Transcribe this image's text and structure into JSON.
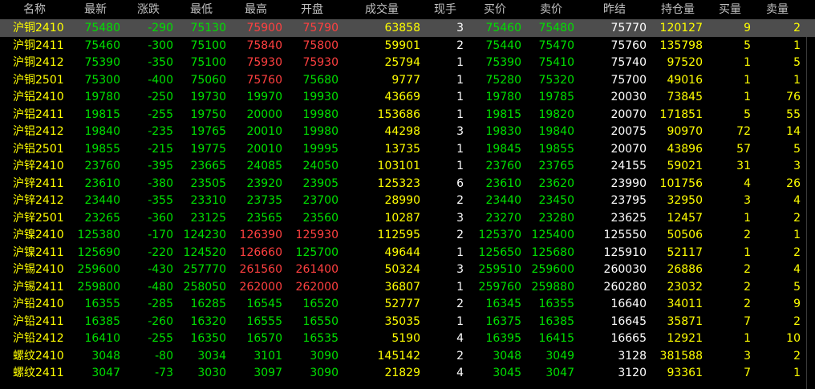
{
  "colors": {
    "background": "#000000",
    "header_text": "#c0c0c0",
    "selected_row_bg": "#4d4d4d",
    "name": "#ffff00",
    "green": "#00e000",
    "red": "#ff4040",
    "white": "#ffffff",
    "yellow": "#ffff00"
  },
  "columns": [
    "名称",
    "最新",
    "涨跌",
    "最低",
    "最高",
    "开盘",
    "成交量",
    "现手",
    "买价",
    "卖价",
    "昨结",
    "持仓量",
    "买量",
    "卖量"
  ],
  "selected_row": 0,
  "rows": [
    [
      "沪铜2410",
      "75480",
      "-290",
      "75130",
      "75900",
      "75790",
      "63858",
      "3",
      "75460",
      "75480",
      "75770",
      "120127",
      "9",
      "2"
    ],
    [
      "沪铜2411",
      "75460",
      "-300",
      "75100",
      "75840",
      "75800",
      "59901",
      "2",
      "75440",
      "75470",
      "75760",
      "135798",
      "5",
      "1"
    ],
    [
      "沪铜2412",
      "75390",
      "-350",
      "75100",
      "75930",
      "75930",
      "25794",
      "1",
      "75390",
      "75410",
      "75740",
      "97520",
      "1",
      "5"
    ],
    [
      "沪铜2501",
      "75300",
      "-400",
      "75060",
      "75760",
      "75680",
      "9777",
      "1",
      "75280",
      "75320",
      "75700",
      "49016",
      "1",
      "1"
    ],
    [
      "沪铝2410",
      "19780",
      "-250",
      "19730",
      "19970",
      "19930",
      "43669",
      "1",
      "19780",
      "19785",
      "20030",
      "73845",
      "1",
      "76"
    ],
    [
      "沪铝2411",
      "19815",
      "-255",
      "19750",
      "20000",
      "19980",
      "153686",
      "1",
      "19815",
      "19820",
      "20070",
      "171851",
      "5",
      "55"
    ],
    [
      "沪铝2412",
      "19840",
      "-235",
      "19765",
      "20010",
      "19980",
      "44298",
      "3",
      "19830",
      "19840",
      "20075",
      "90970",
      "72",
      "14"
    ],
    [
      "沪铝2501",
      "19855",
      "-215",
      "19775",
      "20010",
      "19995",
      "13735",
      "1",
      "19845",
      "19855",
      "20070",
      "43896",
      "57",
      "5"
    ],
    [
      "沪锌2410",
      "23760",
      "-395",
      "23665",
      "24085",
      "24050",
      "103101",
      "1",
      "23760",
      "23765",
      "24155",
      "59021",
      "31",
      "3"
    ],
    [
      "沪锌2411",
      "23610",
      "-380",
      "23505",
      "23920",
      "23905",
      "125323",
      "6",
      "23610",
      "23620",
      "23990",
      "101756",
      "4",
      "26"
    ],
    [
      "沪锌2412",
      "23440",
      "-355",
      "23310",
      "23735",
      "23700",
      "28990",
      "2",
      "23440",
      "23450",
      "23795",
      "32950",
      "3",
      "4"
    ],
    [
      "沪锌2501",
      "23265",
      "-360",
      "23125",
      "23565",
      "23560",
      "10287",
      "3",
      "23270",
      "23280",
      "23625",
      "12457",
      "1",
      "2"
    ],
    [
      "沪镍2410",
      "125380",
      "-170",
      "124230",
      "126390",
      "125930",
      "112595",
      "2",
      "125370",
      "125400",
      "125550",
      "50506",
      "2",
      "1"
    ],
    [
      "沪镍2411",
      "125690",
      "-220",
      "124520",
      "126660",
      "125700",
      "49644",
      "1",
      "125650",
      "125680",
      "125910",
      "52117",
      "1",
      "2"
    ],
    [
      "沪锡2410",
      "259600",
      "-430",
      "257770",
      "261560",
      "261400",
      "50324",
      "3",
      "259510",
      "259600",
      "260030",
      "26886",
      "2",
      "4"
    ],
    [
      "沪锡2411",
      "259800",
      "-480",
      "258050",
      "262000",
      "262000",
      "36807",
      "1",
      "259760",
      "259880",
      "260280",
      "23032",
      "2",
      "5"
    ],
    [
      "沪铅2410",
      "16355",
      "-285",
      "16285",
      "16545",
      "16520",
      "52777",
      "2",
      "16345",
      "16355",
      "16640",
      "34011",
      "2",
      "9"
    ],
    [
      "沪铅2411",
      "16385",
      "-260",
      "16320",
      "16555",
      "16550",
      "35035",
      "1",
      "16375",
      "16385",
      "16645",
      "35871",
      "7",
      "2"
    ],
    [
      "沪铅2412",
      "16410",
      "-255",
      "16350",
      "16570",
      "16535",
      "5190",
      "4",
      "16395",
      "16415",
      "16665",
      "12921",
      "1",
      "10"
    ],
    [
      "螺纹2410",
      "3048",
      "-80",
      "3034",
      "3101",
      "3090",
      "145142",
      "2",
      "3048",
      "3049",
      "3128",
      "381588",
      "3",
      "2"
    ],
    [
      "螺纹2411",
      "3047",
      "-73",
      "3030",
      "3097",
      "3090",
      "21829",
      "4",
      "3045",
      "3047",
      "3120",
      "93361",
      "7",
      "1"
    ]
  ]
}
